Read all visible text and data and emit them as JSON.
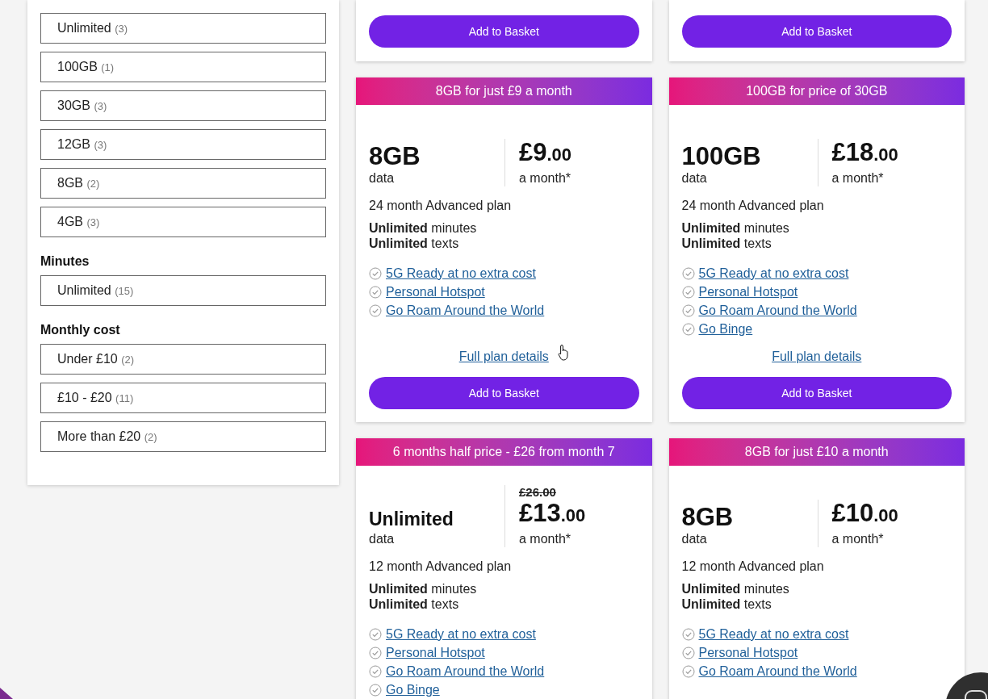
{
  "filters": [
    {
      "options": [
        {
          "label": "Unlimited",
          "count": "(3)"
        },
        {
          "label": "100GB",
          "count": "(1)"
        },
        {
          "label": "30GB",
          "count": "(3)"
        },
        {
          "label": "12GB",
          "count": "(3)"
        },
        {
          "label": "8GB",
          "count": "(2)"
        },
        {
          "label": "4GB",
          "count": "(3)"
        }
      ]
    },
    {
      "title": "Minutes",
      "options": [
        {
          "label": "Unlimited",
          "count": "(15)"
        }
      ]
    },
    {
      "title": "Monthly cost",
      "options": [
        {
          "label": "Under £10",
          "count": "(2)"
        },
        {
          "label": "£10 - £20",
          "count": "(11)"
        },
        {
          "label": "More than £20",
          "count": "(2)"
        }
      ]
    }
  ],
  "top_cards": [
    {
      "button": "Add to Basket"
    },
    {
      "button": "Add to Basket"
    }
  ],
  "plans": [
    {
      "banner": "8GB for just £9 a month",
      "data": "8GB",
      "data_label": "data",
      "price": "£9",
      "pence": ".00",
      "per": "a month*",
      "term": "24 month Advanced plan",
      "minutes": "**Unlimited** minutes",
      "texts": "**Unlimited** texts",
      "features": [
        "5G Ready at no extra cost",
        "Personal Hotspot",
        "Go Roam Around the World"
      ],
      "details": "Full plan details",
      "button": "Add to Basket",
      "hovered": true
    },
    {
      "banner": "100GB for price of 30GB",
      "data": "100GB",
      "data_label": "data",
      "price": "£18",
      "pence": ".00",
      "per": "a month*",
      "term": "24 month Advanced plan",
      "minutes": "**Unlimited** minutes",
      "texts": "**Unlimited** texts",
      "features": [
        "5G Ready at no extra cost",
        "Personal Hotspot",
        "Go Roam Around the World",
        "Go Binge"
      ],
      "details": "Full plan details",
      "button": "Add to Basket",
      "hovered": false
    },
    {
      "banner": "6 months half price - £26 from month 7",
      "data": "Unlimited",
      "data_label": "data",
      "old_price": "£26.00",
      "price": "£13",
      "pence": ".00",
      "per": "a month*",
      "term": "12 month Advanced plan",
      "minutes": "**Unlimited** minutes",
      "texts": "**Unlimited** texts",
      "features": [
        "5G Ready at no extra cost",
        "Personal Hotspot",
        "Go Roam Around the World",
        "Go Binge"
      ],
      "hovered": false
    },
    {
      "banner": "8GB for just £10 a month",
      "data": "8GB",
      "data_label": "data",
      "price": "£10",
      "pence": ".00",
      "per": "a month*",
      "term": "12 month Advanced plan",
      "minutes": "**Unlimited** minutes",
      "texts": "**Unlimited** texts",
      "features": [
        "5G Ready at no extra cost",
        "Personal Hotspot",
        "Go Roam Around the World"
      ],
      "hovered": false
    }
  ]
}
